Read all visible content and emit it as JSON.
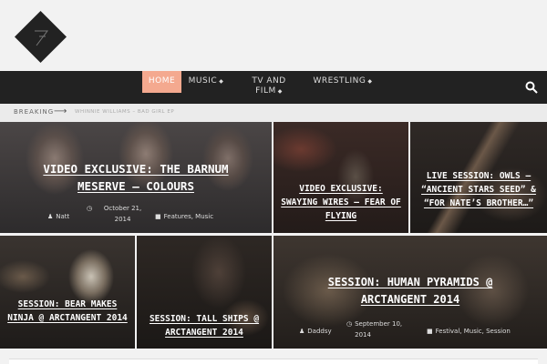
{
  "colors": {
    "accent": "#f4a98f",
    "nav_bg": "#222222",
    "header_bg": "#f2f2f2"
  },
  "nav": {
    "items": [
      {
        "label": "HOME",
        "caret": ""
      },
      {
        "label": "MUSIC",
        "caret": "◆"
      },
      {
        "label": "TV AND FILM",
        "caret": "◆"
      },
      {
        "label": "WRESTLING",
        "caret": "◆"
      }
    ],
    "search_icon": "search-icon"
  },
  "breaking": {
    "label": "BREAKING",
    "arrow": "⟶",
    "headline": "WHINNIE WILLIAMS – BAD GIRL EP"
  },
  "posts": [
    {
      "title": "Video Exclusive: The Barnum Meserve – Colours",
      "author": "Natt",
      "date": "October 21, 2014",
      "categories": "Features, Music"
    },
    {
      "title": "Video Exclusive: Swaying Wires – Fear of Flying",
      "author": "",
      "date": "",
      "categories": ""
    },
    {
      "title": "Live Session: Owls – “Ancient Stars Seed” & “For Nate’s Brother…”",
      "author": "",
      "date": "",
      "categories": ""
    },
    {
      "title": "Session: Bear Makes Ninja @ ArcTanGent 2014",
      "author": "",
      "date": "",
      "categories": ""
    },
    {
      "title": "Session: Tall Ships @ ArcTanGent 2014",
      "author": "",
      "date": "",
      "categories": ""
    },
    {
      "title": "Session: Human Pyramids @ ArcTanGent 2014",
      "author": "Daddsy",
      "date": "September 10, 2014",
      "categories": "Festival, Music, Session"
    }
  ]
}
